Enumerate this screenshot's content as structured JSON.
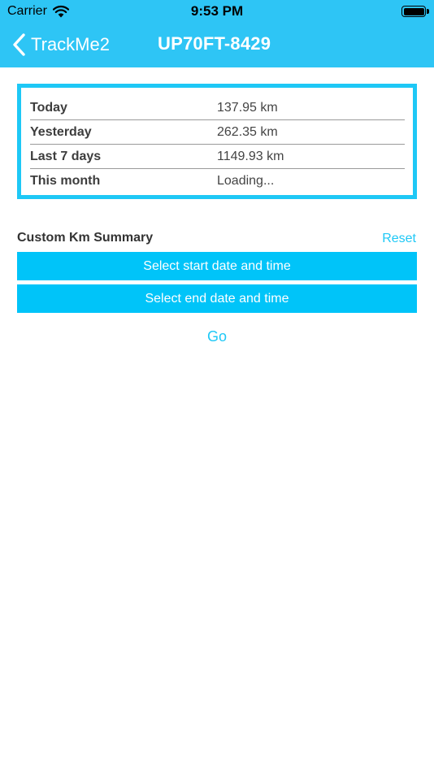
{
  "status_bar": {
    "carrier": "Carrier",
    "time": "9:53 PM"
  },
  "nav": {
    "back_label": "TrackMe2",
    "title": "UP70FT-8429"
  },
  "summary": {
    "rows": [
      {
        "label": "Today",
        "value": "137.95 km"
      },
      {
        "label": "Yesterday",
        "value": "262.35 km"
      },
      {
        "label": "Last 7 days",
        "value": "1149.93 km"
      },
      {
        "label": "This month",
        "value": "Loading..."
      }
    ]
  },
  "custom": {
    "title": "Custom Km Summary",
    "reset_label": "Reset",
    "start_label": "Select start date and time",
    "end_label": "Select end date and time",
    "go_label": "Go"
  },
  "colors": {
    "nav_bar": "#2ec5f5",
    "accent": "#1ec8f6",
    "button": "#00c4f9"
  },
  "icons": {
    "back": "chevron-left-icon",
    "wifi": "wifi-icon",
    "battery": "battery-icon"
  }
}
